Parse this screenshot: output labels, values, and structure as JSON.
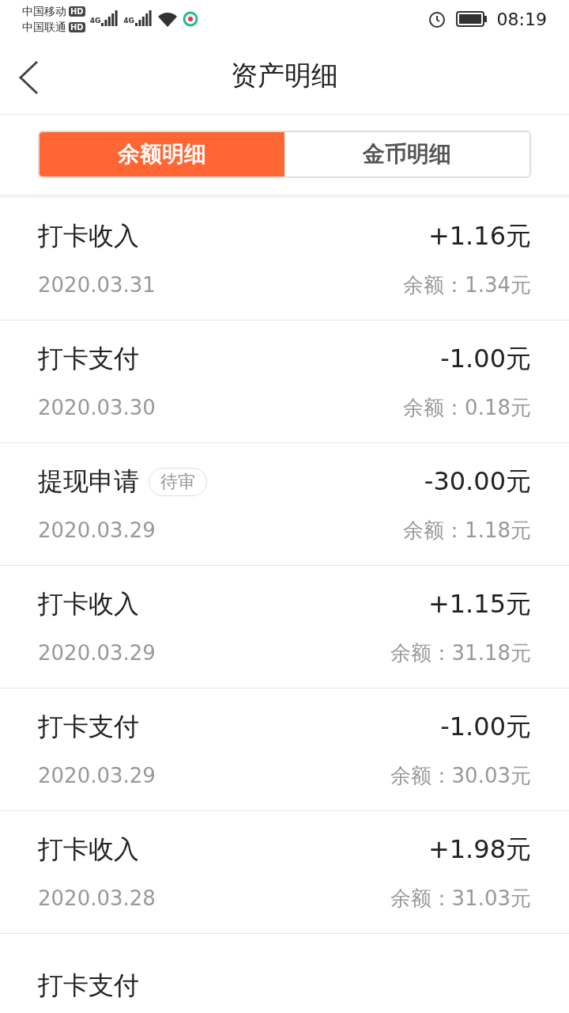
{
  "status_bar": {
    "carriers": [
      {
        "name": "中国移动",
        "badge": "HD"
      },
      {
        "name": "中国联通",
        "badge": "HD"
      }
    ],
    "network_labels": [
      "4G",
      "4G"
    ],
    "time": "08:19"
  },
  "header": {
    "title": "资产明细"
  },
  "tabs": [
    {
      "label": "余额明细",
      "selected": true
    },
    {
      "label": "金币明细",
      "selected": false
    }
  ],
  "records": [
    {
      "title": "打卡收入",
      "amount": "+1.16元",
      "date": "2020.03.31",
      "balance": "余额：1.34元"
    },
    {
      "title": "打卡支付",
      "amount": "-1.00元",
      "date": "2020.03.30",
      "balance": "余额：0.18元"
    },
    {
      "title": "提现申请",
      "tag": "待审",
      "amount": "-30.00元",
      "date": "2020.03.29",
      "balance": "余额：1.18元"
    },
    {
      "title": "打卡收入",
      "amount": "+1.15元",
      "date": "2020.03.29",
      "balance": "余额：31.18元"
    },
    {
      "title": "打卡支付",
      "amount": "-1.00元",
      "date": "2020.03.29",
      "balance": "余额：30.03元"
    },
    {
      "title": "打卡收入",
      "amount": "+1.98元",
      "date": "2020.03.28",
      "balance": "余额：31.03元"
    },
    {
      "title": "打卡支付"
    }
  ]
}
